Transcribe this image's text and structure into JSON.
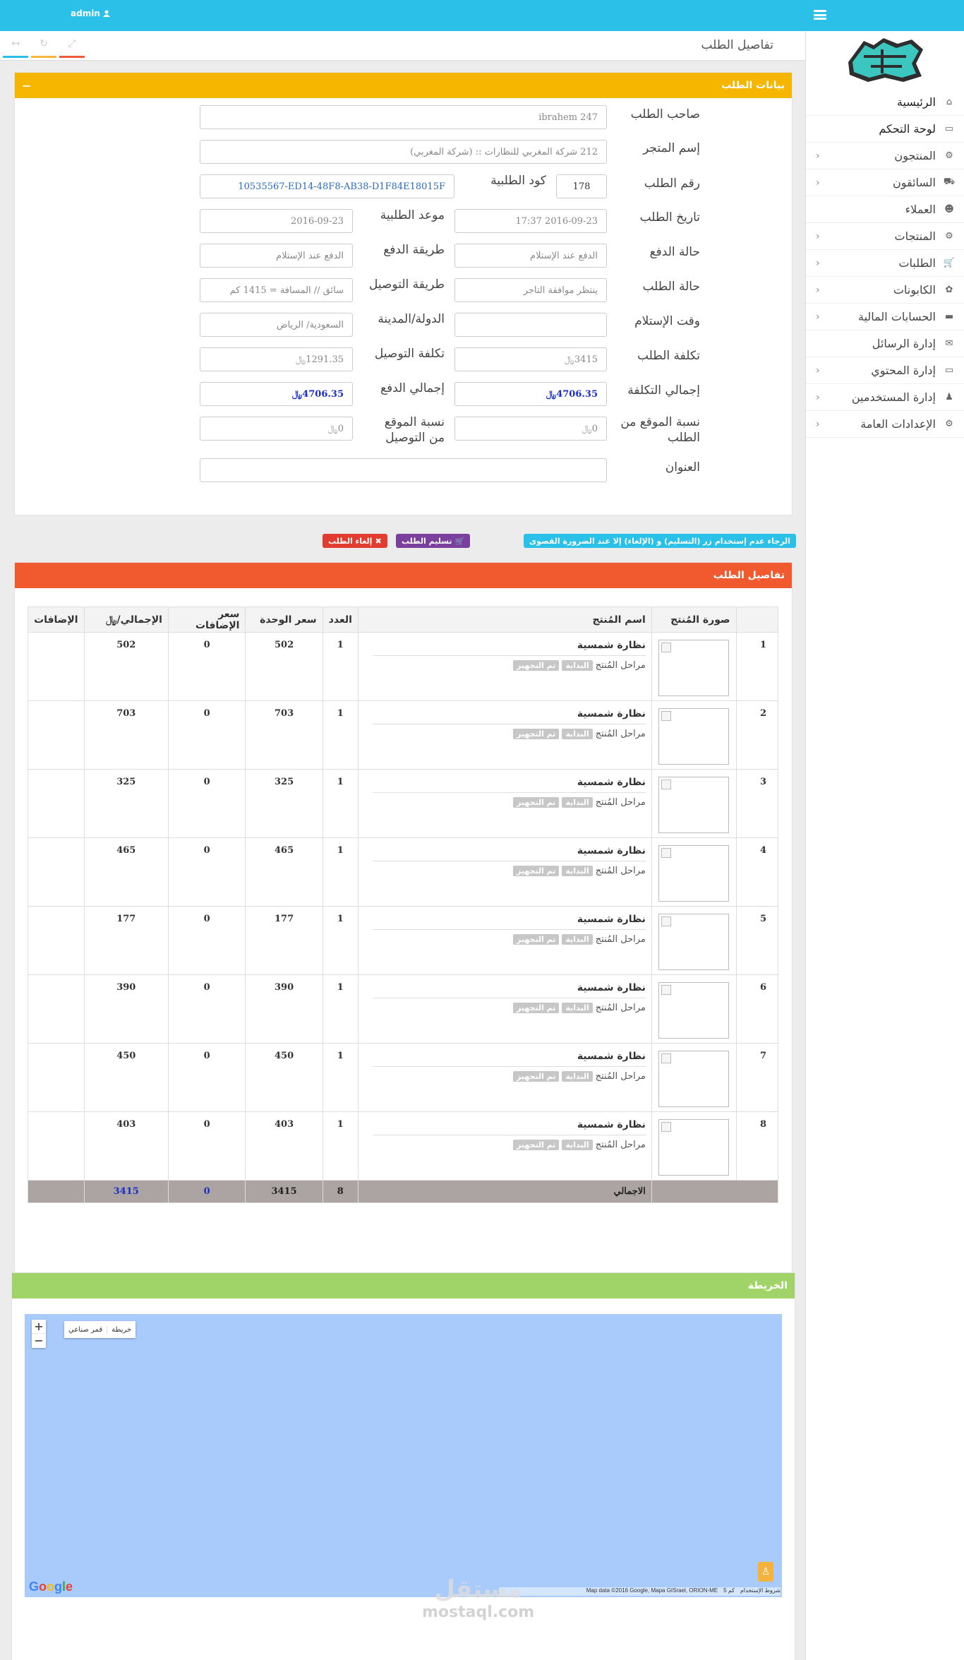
{
  "topbar": {
    "user": "admin",
    "icons": {
      "menu": "menu-icon",
      "user": "user-icon"
    }
  },
  "sidebar": {
    "logo_alt": "تكتك",
    "items": [
      {
        "label": "الرئيسية",
        "icon": "home-icon",
        "has_sub": false
      },
      {
        "label": "لوحة التحكم",
        "icon": "dashboard-icon",
        "has_sub": false
      },
      {
        "label": "المنتجون",
        "icon": "producers-icon",
        "has_sub": true
      },
      {
        "label": "السائقون",
        "icon": "truck-icon",
        "has_sub": true
      },
      {
        "label": "العملاء",
        "icon": "users-icon",
        "has_sub": false
      },
      {
        "label": "المنتجات",
        "icon": "gear-icon",
        "has_sub": true
      },
      {
        "label": "الطلبات",
        "icon": "cart-icon",
        "has_sub": true
      },
      {
        "label": "الكابونات",
        "icon": "gift-icon",
        "has_sub": true
      },
      {
        "label": "الحسابات المالية",
        "icon": "credit-card-icon",
        "has_sub": true
      },
      {
        "label": "إدارة الرسائل",
        "icon": "envelope-icon",
        "has_sub": false
      },
      {
        "label": "إدارة المحتوي",
        "icon": "laptop-icon",
        "has_sub": true
      },
      {
        "label": "إدارة المستخدمين",
        "icon": "user-icon",
        "has_sub": true
      },
      {
        "label": "الإعدادات العامة",
        "icon": "cogs-icon",
        "has_sub": true
      }
    ]
  },
  "page": {
    "title": "تفاصيل الطلب"
  },
  "order_panel": {
    "title": "بيانات الطلب",
    "color": "#f6b600",
    "fields": {
      "owner_label": "صاحب الطلب",
      "owner_value": "ibrahem   247",
      "store_label": "إسم المتجر",
      "store_value": "212   شركة المغربي للنظارات :: (شركة المغربي)",
      "order_no_label": "رقم الطلب",
      "order_no_value": "10535567-ED14-48F8-AB38-D1F84E18015F",
      "order_code_label": "كود الطلبية",
      "order_code_value": "178",
      "order_date_label": "تاريخ الطلب",
      "order_date_value": "2016-09-23 17:37",
      "appointment_label": "موعد الطلبية",
      "appointment_value": "2016-09-23",
      "payment_status_label": "حالة الدفع",
      "payment_status_value": "الدفع عند الإستلام",
      "payment_method_label": "طريقة الدفع",
      "payment_method_value": "الدفع عند الإستلام",
      "order_status_label": "حالة الطلب",
      "order_status_value": "ينتظر موافقة التاجر",
      "delivery_method_label": "طريقة التوصيل",
      "delivery_method_value": "سائق //    المسافة = 1415 كم",
      "receipt_time_label": "وقت الإستلام",
      "receipt_time_value": "",
      "city_label": "الدولة/المدينة",
      "city_value": "السعودية/ الرياض",
      "order_cost_label": "تكلفة الطلب",
      "order_cost_value": "3415",
      "delivery_cost_label": "تكلفة التوصيل",
      "delivery_cost_value": "1291.35",
      "total_cost_label": "إجمالي التكلفة",
      "total_cost_value": "4706.35",
      "total_paid_label": "إجمالي الدفع",
      "total_paid_value": "4706.35",
      "site_ratio_order_label": "نسبة الموقع من الطلب",
      "site_ratio_order_value": "0",
      "site_ratio_delivery_label": "نسبة الموقع من التوصيل",
      "site_ratio_delivery_value": "0",
      "address_label": "العنوان",
      "address_value": "",
      "currency": "﷼"
    }
  },
  "actions": {
    "notice": "الرجاء عدم إستخدام زر (التسليم) و (الإلغاء) إلا عند الضرورة القصوى",
    "deliver_label": "تسليم الطلب",
    "cancel_label": "إلغاء الطلب",
    "colors": {
      "notice": "#2bc0e8",
      "deliver": "#7b3f9e",
      "cancel": "#e23c30"
    }
  },
  "items_panel": {
    "title": "تفاصيل الطلب",
    "color": "#f05a2e",
    "columns": [
      "",
      "صورة المُنتج",
      "اسم المُنتج",
      "العدد",
      "سعر الوحدة",
      "سعر الإضافات",
      "الإجمالي/﷼",
      "الإضافات"
    ],
    "rows": [
      {
        "n": "1",
        "name": "نظارة شمسية",
        "stages": "مراحل المُنتج",
        "tag1": "البداية",
        "tag2": "تم التجهيز",
        "qty": "1",
        "unit": "502",
        "extras": "0",
        "total": "502"
      },
      {
        "n": "2",
        "name": "نظارة شمسية",
        "stages": "مراحل المُنتج",
        "tag1": "البداية",
        "tag2": "تم التجهيز",
        "qty": "1",
        "unit": "703",
        "extras": "0",
        "total": "703"
      },
      {
        "n": "3",
        "name": "نظارة شمسية",
        "stages": "مراحل المُنتج",
        "tag1": "البداية",
        "tag2": "تم التجهيز",
        "qty": "1",
        "unit": "325",
        "extras": "0",
        "total": "325"
      },
      {
        "n": "4",
        "name": "نظارة شمسية",
        "stages": "مراحل المُنتج",
        "tag1": "البداية",
        "tag2": "تم التجهيز",
        "qty": "1",
        "unit": "465",
        "extras": "0",
        "total": "465"
      },
      {
        "n": "5",
        "name": "نظارة شمسية",
        "stages": "مراحل المُنتج",
        "tag1": "البداية",
        "tag2": "تم التجهيز",
        "qty": "1",
        "unit": "177",
        "extras": "0",
        "total": "177"
      },
      {
        "n": "6",
        "name": "نظارة شمسية",
        "stages": "مراحل المُنتج",
        "tag1": "البداية",
        "tag2": "تم التجهيز",
        "qty": "1",
        "unit": "390",
        "extras": "0",
        "total": "390"
      },
      {
        "n": "7",
        "name": "نظارة شمسية",
        "stages": "مراحل المُنتج",
        "tag1": "البداية",
        "tag2": "تم التجهيز",
        "qty": "1",
        "unit": "450",
        "extras": "0",
        "total": "450"
      },
      {
        "n": "8",
        "name": "نظارة شمسية",
        "stages": "مراحل المُنتج",
        "tag1": "البداية",
        "tag2": "تم التجهيز",
        "qty": "1",
        "unit": "403",
        "extras": "0",
        "total": "403"
      }
    ],
    "totals": {
      "label": "الاجمالي",
      "qty": "8",
      "unit": "3415",
      "extras": "0",
      "total": "3415"
    }
  },
  "map_panel": {
    "title": "الخريطة",
    "color": "#a0d468",
    "zoom_in": "+",
    "zoom_out": "−",
    "map_type_map": "خريطة",
    "map_type_satellite": "قمر صناعي",
    "google": "Google",
    "attribution": "Map data ©2016 Google, Mapa GISrael, ORION-ME",
    "scale": "5 كم",
    "terms": "شروط الإستخدام"
  },
  "watermark": {
    "arabic": "مستقل",
    "latin": "mostaql.com"
  }
}
